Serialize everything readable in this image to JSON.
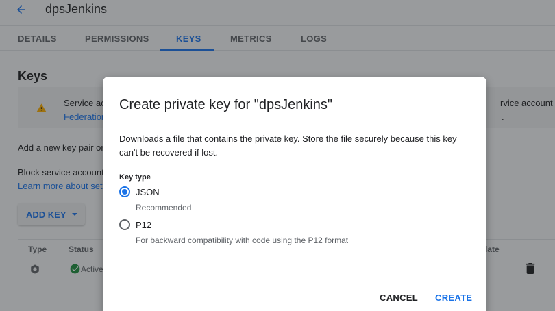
{
  "header": {
    "title": "dpsJenkins",
    "back_icon": "arrow-back-icon"
  },
  "tabs": [
    {
      "label": "DETAILS",
      "active": false
    },
    {
      "label": "PERMISSIONS",
      "active": false
    },
    {
      "label": "KEYS",
      "active": true
    },
    {
      "label": "METRICS",
      "active": false
    },
    {
      "label": "LOGS",
      "active": false
    }
  ],
  "keys_section": {
    "heading": "Keys",
    "warning_text": "Service ac",
    "warning_link": "Federation",
    "warning_text_right": "rvice account keys",
    "warning_text_right_2": ".",
    "add_key_text": "Add a new key pair or",
    "block_text": "Block service account",
    "learn_link": "Learn more about set",
    "add_key_button": "ADD KEY"
  },
  "table": {
    "columns": [
      "Type",
      "Status",
      "late"
    ],
    "rows": [
      {
        "status": "Active"
      }
    ]
  },
  "dialog": {
    "title": "Create private key for \"dpsJenkins\"",
    "description": "Downloads a file that contains the private key. Store the file securely because this key can't be recovered if lost.",
    "key_type_label": "Key type",
    "options": [
      {
        "label": "JSON",
        "description": "Recommended",
        "selected": true
      },
      {
        "label": "P12",
        "description": "For backward compatibility with code using the P12 format",
        "selected": false
      }
    ],
    "cancel_label": "CANCEL",
    "create_label": "CREATE"
  },
  "colors": {
    "accent": "#1a73e8",
    "warning": "#f9ab00",
    "success": "#1e8e3e"
  }
}
